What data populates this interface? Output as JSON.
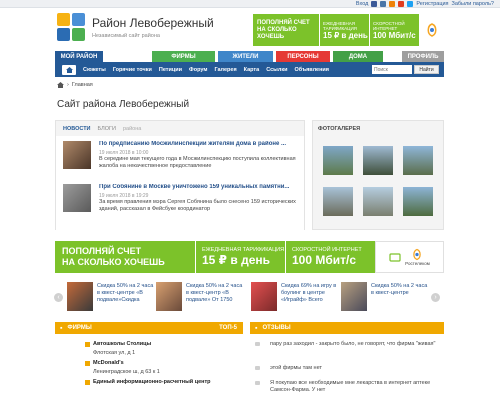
{
  "topbar": {
    "login": "Вход",
    "registration": "Регистрация",
    "forgot": "Забыли пароль?"
  },
  "site": {
    "title": "Район Левобережный",
    "subtitle": "Независимый сайт района"
  },
  "header_ad": {
    "main": "ПОПОЛНЯЙ СЧЕТ НА СКОЛЬКО ХОЧЕШЬ",
    "tariff_label": "ЕЖЕДНЕВНАЯ ТАРИФИКАЦИЯ",
    "tariff_value": "15 ₽ в день",
    "speed_label": "СКОРОСТНОЙ ИНТЕРНЕТ",
    "speed_value": "100 Мбит/с"
  },
  "nav": {
    "my_area": "МОЙ РАЙОН",
    "firms": "ФИРМЫ",
    "residents": "ЖИТЕЛИ",
    "persons": "ПЕРСОНЫ",
    "home": "ДОМА",
    "profile": "ПРОФИЛЬ"
  },
  "subnav": {
    "items": [
      "Сюжеты",
      "Горячие точки",
      "Петиции",
      "Форум",
      "Галерея",
      "Карта",
      "Ссылки",
      "Объявления"
    ],
    "search_placeholder": "Поиск",
    "search_button": "Найти"
  },
  "breadcrumb": {
    "home": "Главная"
  },
  "page_title": "Сайт района Левобережный",
  "news": {
    "tabs": [
      "НОВОСТИ",
      "БЛОГИ",
      "района"
    ],
    "items": [
      {
        "title": "По предписанию Мосжилинспекции жителям дома в районе ...",
        "date": "19 июля 2018 в 10:00",
        "text": "В середине мая текущего года в Мосжилинспекцию поступила коллективная жалоба на некачественное предоставление"
      },
      {
        "title": "При Собянине в Москве уничтожено 159 уникальных памятни...",
        "date": "19 июля 2018 в 19:29",
        "text": "За время правления мэра Сергея Собянина было снесено 159 исторических зданий, рассказал в Фейсбуке координатор"
      }
    ]
  },
  "gallery": {
    "title": "ФОТОГАЛЕРЕЯ"
  },
  "banner": {
    "main_line1": "ПОПОЛНЯЙ СЧЕТ",
    "main_line2": "НА СКОЛЬКО ХОЧЕШЬ",
    "tariff_label": "ЕЖЕДНЕВНАЯ ТАРИФИКАЦИЯ",
    "tariff_value": "15 ₽ в день",
    "speed_label": "СКОРОСТНОЙ ИНТЕРНЕТ",
    "speed_value": "100 Мбит/с",
    "brand": "Ростелеком"
  },
  "promos": [
    "Скидка 50% на 2 часа в квест-центре «В подвале»Скидка",
    "Скидка 50% на 2 часа в квест-центр «В подвале» От 1750",
    "Скидка 69% на игру в боулинг в центре «Играйф» Всего",
    "Скидка 50% на 2 часа в квест-центре"
  ],
  "firms": {
    "title": "ФИРМЫ",
    "badge": "ТОП-5",
    "items": [
      {
        "name": "Автошколы Столицы",
        "address": "Флотская ул, д 1"
      },
      {
        "name": "McDonald's",
        "address": "Ленинградское ш, д 63 к 1"
      },
      {
        "name": "Единый информационно-расчетный центр",
        "address": ""
      }
    ]
  },
  "reviews": {
    "title": "ОТЗЫВЫ",
    "items": [
      "пару раз заходил - закрыто было, не говорят, что фирма \"живая\"",
      "этой фирмы там нет",
      "Я покупаю все необходимые мне лекарства в интернет аптеке Самсон-Фарма. У нет"
    ]
  },
  "colors": {
    "nav_blue": "#245996",
    "nav_green": "#4caf50",
    "nav_red": "#e53935",
    "accent_orange": "#f0a800",
    "ad_green": "#7cc22a"
  }
}
